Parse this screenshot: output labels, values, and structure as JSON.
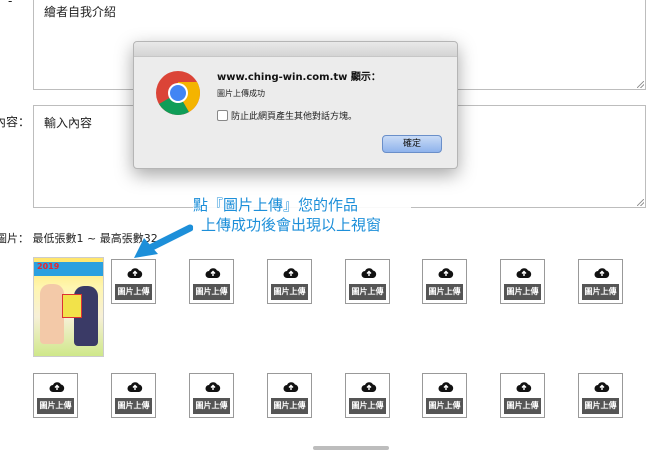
{
  "form": {
    "intro_placeholder": "繪者自我介紹",
    "intro_label_fragment": "-",
    "content_label": "內容：",
    "content_placeholder": "輸入內容",
    "images_label": "圖片：  最低張數1 ~ 最高張數32",
    "upload_button_label": "圖片上傳"
  },
  "dialog": {
    "title": "www.ching-win.com.tw 顯示：",
    "message": "圖片上傳成功",
    "checkbox_label": "防止此網頁產生其他對話方塊。",
    "ok_label": "確定"
  },
  "annotation": {
    "line1": "點『圖片上傳』您的作品",
    "line2": "上傳成功後會出現以上視窗",
    "color": "#1d8fd9"
  },
  "thumbnail": {
    "year_text": "2019"
  },
  "icons": {
    "upload": "cloud-upload-icon",
    "browser": "chrome-logo-icon"
  }
}
